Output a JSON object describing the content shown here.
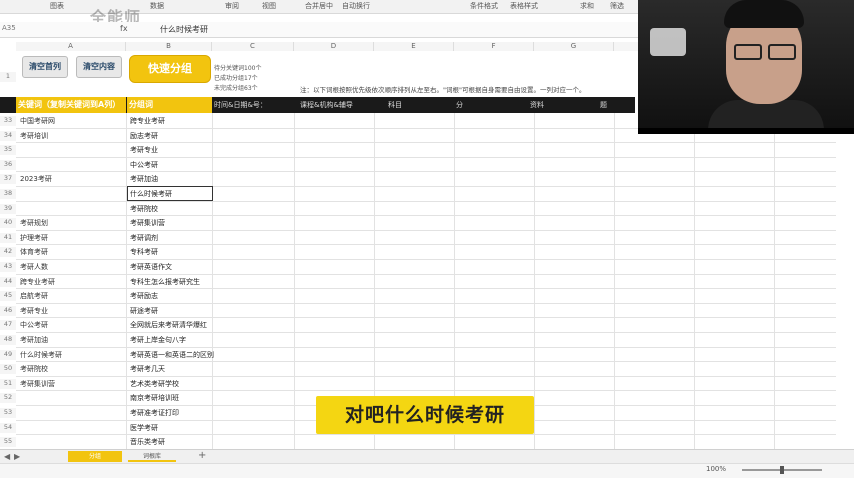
{
  "ribbon": {
    "items": [
      "图表",
      "数据",
      "审阅",
      "视图",
      "合并居中",
      "自动换行",
      "条件格式",
      "表格样式",
      "求和",
      "筛选"
    ],
    "watermark": "全能师"
  },
  "formula_bar": {
    "name_box": "A35",
    "fx": "fx",
    "content": "什么时候考研"
  },
  "columns": [
    "A",
    "B",
    "C",
    "D",
    "E",
    "F",
    "G",
    "H",
    "I"
  ],
  "buttons": {
    "clear_cols": "清空首列",
    "clear_content": "清空内容",
    "fast_group": "快速分组"
  },
  "stats": [
    "待分关键词100个",
    "已成功分组17个",
    "未完成分组63个"
  ],
  "note": "注：以下词根按照优先级依次顺序排列从左至右。\"词根\"可根据自身需要自由设置。一列对应一个。",
  "header": {
    "col_a": "关键词（复制关键词到A列）",
    "col_b": "分组词",
    "rest": [
      "时间&日期&号：",
      "课程&机构&辅导",
      "科目",
      "分",
      "资料",
      "题"
    ]
  },
  "row_numbers": [
    "1",
    "2",
    "33",
    "34",
    "35",
    "36",
    "37",
    "38",
    "39",
    "40",
    "41",
    "42",
    "43",
    "44",
    "45",
    "46",
    "47",
    "48",
    "49",
    "50",
    "51",
    "52",
    "53",
    "54",
    "55",
    "56",
    "57",
    "58",
    "59",
    "60",
    "61",
    "62"
  ],
  "rows": [
    {
      "a": "中国考研网",
      "b": "跨专业考研"
    },
    {
      "a": "考研培训",
      "b": "励志考研"
    },
    {
      "a": "",
      "b": "考研专业"
    },
    {
      "a": "",
      "b": "中公考研"
    },
    {
      "a": "2023考研",
      "b": "考研加油"
    },
    {
      "a": "",
      "b": "什么时候考研"
    },
    {
      "a": "",
      "b": "考研院校"
    },
    {
      "a": "考研规划",
      "b": "考研集训营"
    },
    {
      "a": "护理考研",
      "b": "考研调剂"
    },
    {
      "a": "体育考研",
      "b": "专科考研"
    },
    {
      "a": "考研人数",
      "b": "考研英语作文"
    },
    {
      "a": "跨专业考研",
      "b": "专科生怎么报考研究生"
    },
    {
      "a": "启航考研",
      "b": "考研励志"
    },
    {
      "a": "考研专业",
      "b": "研途考研"
    },
    {
      "a": "中公考研",
      "b": "全网就后来考研清华爆红"
    },
    {
      "a": "考研加油",
      "b": "考研上岸金句八字"
    },
    {
      "a": "什么时候考研",
      "b": "考研英语一和英语二的区别"
    },
    {
      "a": "考研院校",
      "b": "考研考几天"
    },
    {
      "a": "考研集训营",
      "b": "艺术类考研学校"
    },
    {
      "a": "",
      "b": "南京考研培训班"
    },
    {
      "a": "",
      "b": "考研准考证打印"
    },
    {
      "a": "",
      "b": "医学考研"
    },
    {
      "a": "",
      "b": "音乐类考研"
    }
  ],
  "caption": "对吧什么时候考研",
  "sheets": [
    "分组",
    "词根库"
  ],
  "status": {
    "zoom": "100%"
  }
}
